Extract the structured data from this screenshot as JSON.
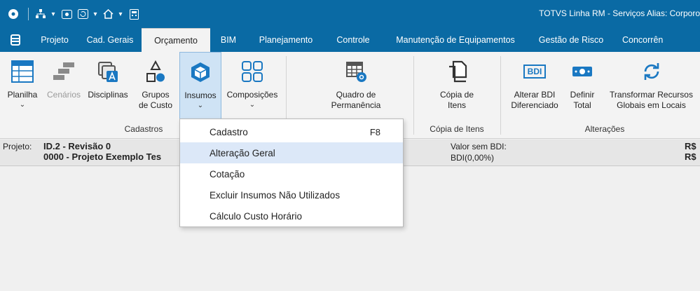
{
  "window": {
    "title": "TOTVS Linha RM - Serviços  Alias: Corporo"
  },
  "quick_access": [
    "app-icon",
    "sitemap-icon",
    "eye-icon",
    "refresh-icon",
    "home-icon",
    "calculator-icon"
  ],
  "tabs": [
    "Projeto",
    "Cad. Gerais",
    "Orçamento",
    "BIM",
    "Planejamento",
    "Controle",
    "Manutenção de Equipamentos",
    "Gestão de Risco",
    "Concorrên"
  ],
  "active_tab": "Orçamento",
  "ribbon": {
    "cadastros": {
      "group_label": "Cadastros",
      "planilha": "Planilha",
      "cenarios": "Cenários",
      "disciplinas": "Disciplinas",
      "grupos_l1": "Grupos",
      "grupos_l2": "de Custo",
      "insumos": "Insumos",
      "composicoes": "Composições"
    },
    "quadro": {
      "l1": "Quadro de",
      "l2": "Permanência"
    },
    "copia": {
      "l1": "Cópia de",
      "l2": "Itens",
      "group_label": "Cópia de Itens"
    },
    "alteracoes": {
      "group_label": "Alterações",
      "alterar_l1": "Alterar BDI",
      "alterar_l2": "Diferenciado",
      "definir_l1": "Definir",
      "definir_l2": "Total",
      "transformar_l1": "Transformar Recursos",
      "transformar_l2": "Globais em Locais",
      "bdi_badge": "BDI"
    }
  },
  "info": {
    "projeto_label": "Projeto:",
    "projeto_line1": "ID.2 - Revisão 0",
    "projeto_line2": "0000 - Projeto Exemplo Tes",
    "valor_sem_bdi": "Valor sem BDI:",
    "bdi": "BDI(0,00%)",
    "currency1": "R$",
    "currency2": "R$"
  },
  "dropdown": {
    "items": [
      {
        "label": "Cadastro",
        "shortcut": "F8"
      },
      {
        "label": "Alteração Geral",
        "shortcut": ""
      },
      {
        "label": "Cotação",
        "shortcut": ""
      },
      {
        "label": "Excluir Insumos Não Utilizados",
        "shortcut": ""
      },
      {
        "label": "Cálculo Custo Horário",
        "shortcut": ""
      }
    ],
    "highlighted": "Alteração Geral"
  },
  "colors": {
    "titlebar": "#0a6aa4",
    "accent_blue": "#1a78c2",
    "icon_gray": "#8a8a8a",
    "highlight": "#dce8f8"
  }
}
